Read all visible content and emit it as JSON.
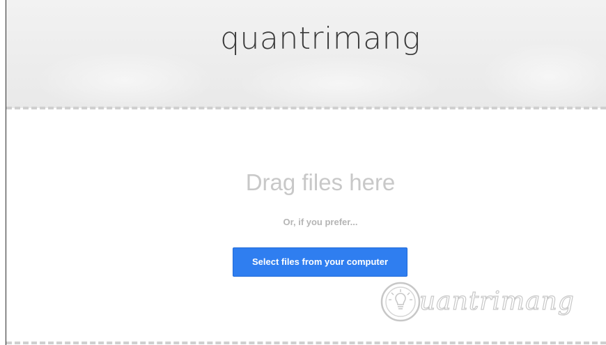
{
  "header": {
    "title": "quantrimang"
  },
  "drop_zone": {
    "heading": "Drag files here",
    "subtext": "Or, if you prefer...",
    "button_label": "Select files from your computer"
  },
  "watermark": {
    "text": "uantrimang"
  },
  "colors": {
    "button_background": "#2f7ef0",
    "header_background": "#eeeeee",
    "dashed_border": "#cfcfcf",
    "heading_text": "#c8c8c8"
  },
  "icons": {
    "watermark_logo": "lightbulb-icon"
  }
}
